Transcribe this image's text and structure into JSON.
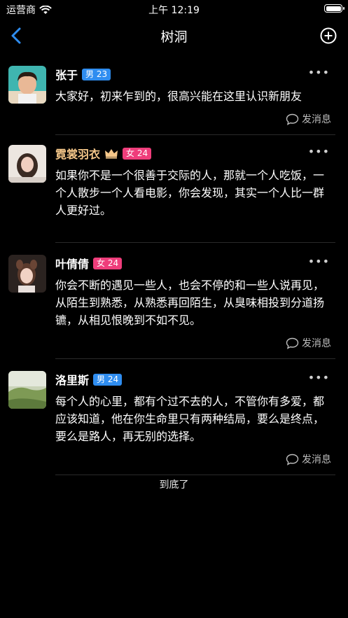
{
  "status": {
    "carrier": "运营商",
    "time": "上午 12:19"
  },
  "nav": {
    "title": "树洞"
  },
  "posts": [
    {
      "name": "张于",
      "gender": "男",
      "age": "23",
      "text": "大家好，初来乍到的，很高兴能在这里认识新朋友",
      "msg": "发消息",
      "vip": false
    },
    {
      "name": "霓裳羽衣",
      "gender": "女",
      "age": "24",
      "text": "如果你不是一个很善于交际的人，那就一个人吃饭，一个人散步一个人看电影，你会发现，其实一个人比一群人更好过。",
      "msg": "",
      "vip": true
    },
    {
      "name": "叶倩倩",
      "gender": "女",
      "age": "24",
      "text": "你会不断的遇见一些人，也会不停的和一些人说再见，从陌生到熟悉，从熟悉再回陌生，从臭味相投到分道扬镳，从相见恨晚到不如不见。",
      "msg": "发消息",
      "vip": false
    },
    {
      "name": "洛里斯",
      "gender": "男",
      "age": "24",
      "text": "每个人的心里，都有个过不去的人，不管你有多爱，都应该知道，他在你生命里只有两种结局，要么是终点，要么是路人，再无别的选择。",
      "msg": "发消息",
      "vip": false
    }
  ],
  "footer": {
    "end_text": "到底了"
  },
  "colors": {
    "background": "#000000",
    "accent": "#2f8df0",
    "female_badge": "#ef3d7b",
    "vip_name": "#f5c78a"
  }
}
